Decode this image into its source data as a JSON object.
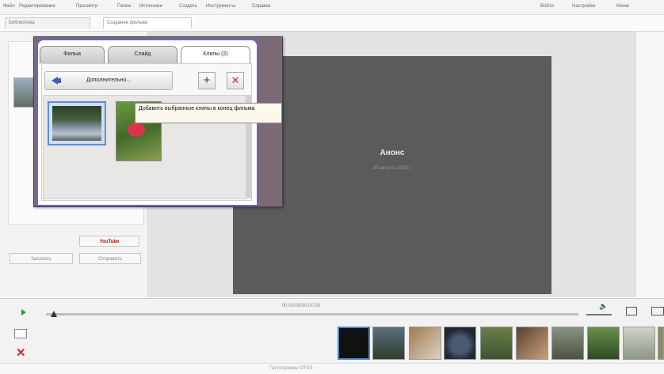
{
  "menu": {
    "items": [
      "Файл",
      "Редактирование",
      "Просмотр",
      "Папка",
      "Источники",
      "Создать",
      "Инструменты",
      "Справка"
    ],
    "right_items": [
      "Войти",
      "Настройки",
      "Меню"
    ]
  },
  "tabs": [
    {
      "label": "Библиотека"
    },
    {
      "label": "Создание фильма"
    }
  ],
  "left_panel": {
    "youtube_button": "YouTube",
    "button_left": "Записать",
    "button_right": "Отправить"
  },
  "dialog": {
    "tabs": [
      {
        "label": "Фильм"
      },
      {
        "label": "Слайд"
      },
      {
        "label": "Клипы (2)"
      }
    ],
    "more_button": "Дополнительно...",
    "add_symbol": "+",
    "remove_symbol": "✕",
    "tooltip": "Добавить выбранные клипы в конец фильма"
  },
  "preview": {
    "title": "Анонс",
    "date": "20 августа 2008 г."
  },
  "timeline": {
    "time_label": "00:00:00/00:00:30",
    "status": "Гистограммы ОТКЛ"
  },
  "colors": {
    "accent": "#6d63c9",
    "preview_bg": "#5b5b5b",
    "delete_red": "#d42b2b",
    "play_green": "#2a9a2a"
  },
  "icons": [
    "play-icon",
    "volume-icon",
    "fullscreen-icon",
    "add-icon",
    "remove-icon",
    "back-arrow-icon",
    "delete-icon",
    "storyboard-icon"
  ]
}
